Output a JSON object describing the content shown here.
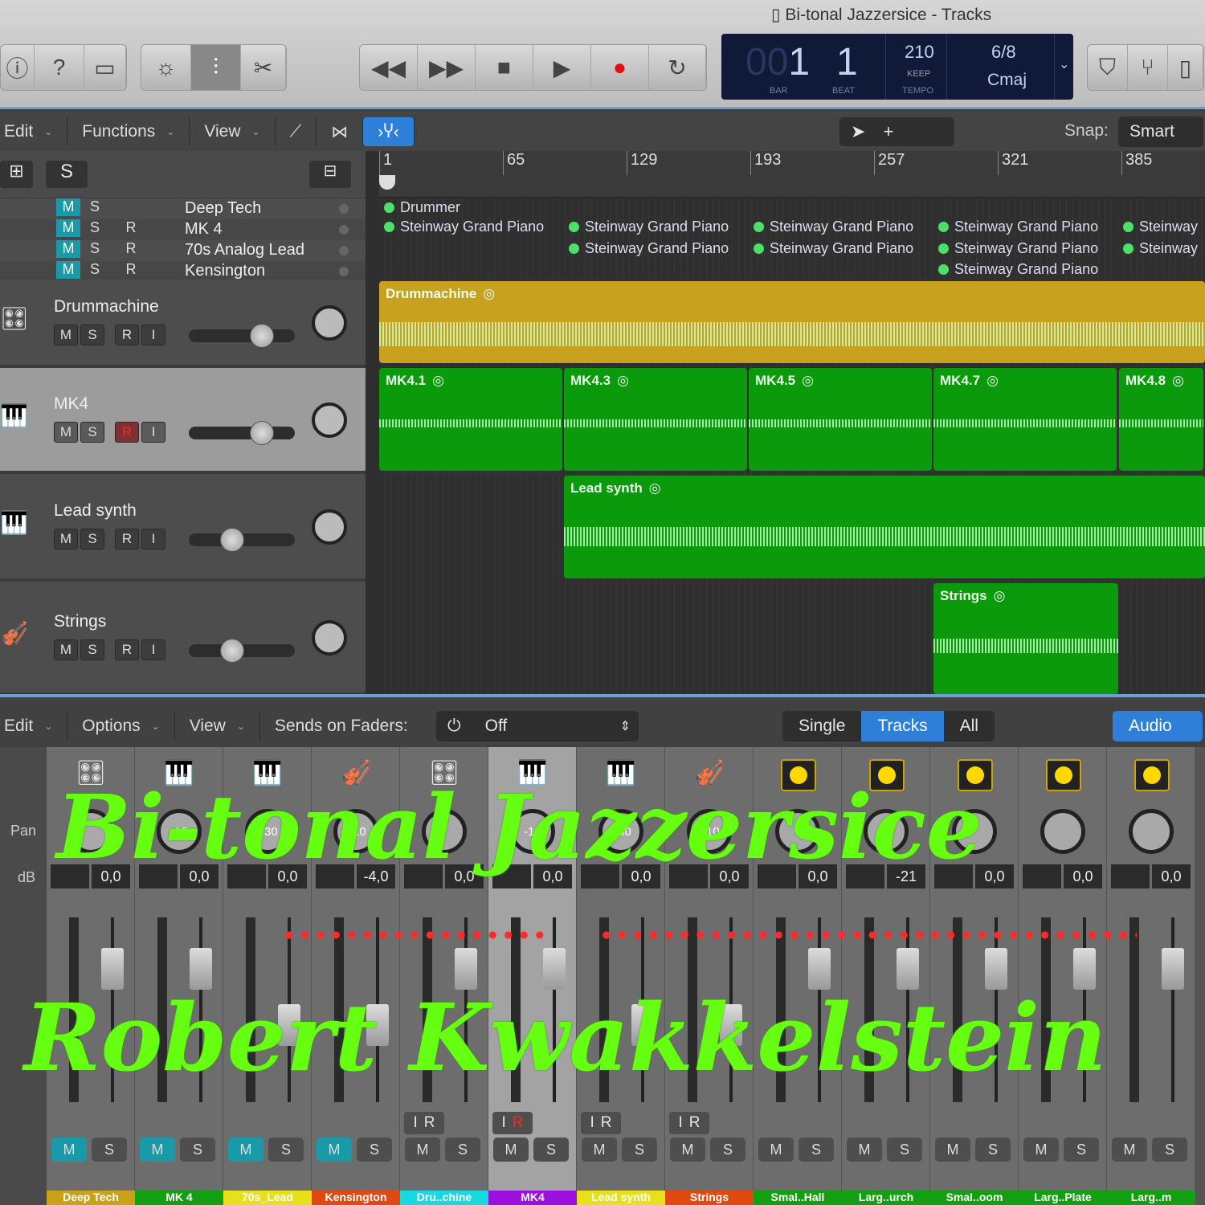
{
  "window": {
    "title": "Bi-tonal Jazzersice - Tracks"
  },
  "lcd": {
    "bar_dim": "00",
    "bar": "1",
    "beat": "1",
    "bar_label": "BAR",
    "beat_label": "BEAT",
    "tempo": "210",
    "tempo_mode": "KEEP",
    "tempo_label": "TEMPO",
    "signature": "6/8",
    "key": "Cmaj"
  },
  "tracks_toolbar": {
    "edit": "Edit",
    "functions": "Functions",
    "view": "View",
    "snap_label": "Snap:",
    "snap_value": "Smart",
    "s_button": "S"
  },
  "ruler": [
    "1",
    "65",
    "129",
    "193",
    "257",
    "321",
    "385"
  ],
  "summary_tracks": [
    {
      "name": "Deep Tech",
      "m": "M",
      "s": "S",
      "r": ""
    },
    {
      "name": "MK 4",
      "m": "M",
      "s": "S",
      "r": "R"
    },
    {
      "name": "70s Analog Lead",
      "m": "M",
      "s": "S",
      "r": "R"
    },
    {
      "name": "Kensington",
      "m": "M",
      "s": "S",
      "r": "R"
    }
  ],
  "tracks": [
    {
      "name": "Drummachine",
      "icon": "drum-machine-icon",
      "selected": false,
      "fader": 0.7,
      "buttons": [
        "M",
        "S",
        "R",
        "I"
      ]
    },
    {
      "name": "MK4",
      "icon": "electric-piano-icon",
      "selected": true,
      "fader": 0.7,
      "buttons": [
        "M",
        "S",
        "R",
        "I"
      ]
    },
    {
      "name": "Lead synth",
      "icon": "synth-icon",
      "selected": false,
      "fader": 0.42,
      "buttons": [
        "M",
        "S",
        "R",
        "I"
      ]
    },
    {
      "name": "Strings",
      "icon": "strings-icon",
      "selected": false,
      "fader": 0.42,
      "buttons": [
        "M",
        "S",
        "R",
        "I"
      ]
    }
  ],
  "summary_regions": {
    "drummer": "Drummer",
    "piano": "Steinway Grand Piano",
    "piano_short": "Steinway"
  },
  "regions": {
    "drummachine": "Drummachine",
    "mk4": [
      "MK4.1",
      "MK4.3",
      "MK4.5",
      "MK4.7",
      "MK4.8"
    ],
    "lead": "Lead synth",
    "strings": "Strings"
  },
  "mixer_toolbar": {
    "edit": "Edit",
    "options": "Options",
    "view": "View",
    "sends_label": "Sends on Faders:",
    "sends_value": "Off",
    "single": "Single",
    "tracks": "Tracks",
    "all": "All",
    "audio": "Audio",
    "pan_label": "Pan",
    "db_label": "dB"
  },
  "strips": [
    {
      "name": "Deep Tech",
      "color": "#c9a21a",
      "icon": "drum-machine-icon",
      "pan": "",
      "db": "0,0",
      "m_on": true
    },
    {
      "name": "MK 4",
      "color": "#12a012",
      "icon": "electric-piano-icon",
      "pan": "-15",
      "db": "0,0",
      "m_on": true
    },
    {
      "name": "70s_Lead",
      "color": "#e8e01a",
      "icon": "synth-icon",
      "pan": "+30",
      "db": "0,0",
      "m_on": true
    },
    {
      "name": "Kensington",
      "color": "#e04a10",
      "icon": "strings-icon",
      "pan": "+10",
      "db": "-4,0",
      "m_on": true
    },
    {
      "name": "Dru..chine",
      "color": "#18d8e0",
      "icon": "drum-machine-icon",
      "pan": "",
      "db": "0,0",
      "m_on": false
    },
    {
      "name": "MK4",
      "color": "#9a10e0",
      "icon": "electric-piano-icon",
      "pan": "-15",
      "db": "0,0",
      "m_on": false
    },
    {
      "name": "Lead synth",
      "color": "#e8e01a",
      "icon": "synth-icon",
      "pan": "+30",
      "db": "0,0",
      "m_on": false
    },
    {
      "name": "Strings",
      "color": "#e04a10",
      "icon": "strings-icon",
      "pan": "+10",
      "db": "0,0",
      "m_on": false
    },
    {
      "name": "Smal..Hall",
      "color": "#12a012",
      "icon": "aux-icon",
      "pan": "",
      "db": "0,0",
      "m_on": false
    },
    {
      "name": "Larg..urch",
      "color": "#12a012",
      "icon": "aux-icon",
      "pan": "",
      "db": "-21",
      "m_on": false
    },
    {
      "name": "Smal..oom",
      "color": "#12a012",
      "icon": "aux-icon",
      "pan": "",
      "db": "0,0",
      "m_on": false
    },
    {
      "name": "Larg..Plate",
      "color": "#12a012",
      "icon": "aux-icon",
      "pan": "",
      "db": "0,0",
      "m_on": false
    },
    {
      "name": "Larg..m",
      "color": "#12a012",
      "icon": "aux-icon",
      "pan": "",
      "db": "0,0",
      "m_on": false
    }
  ],
  "overlay": {
    "line1": "Bi-tonal Jazzersice",
    "line2": "Robert Kwakkelstein"
  },
  "colors": {
    "accent": "#1a9aa8",
    "region_green": "#0b9a0b",
    "region_yellow": "#c8a21e",
    "overlay_green": "#66ff11"
  }
}
